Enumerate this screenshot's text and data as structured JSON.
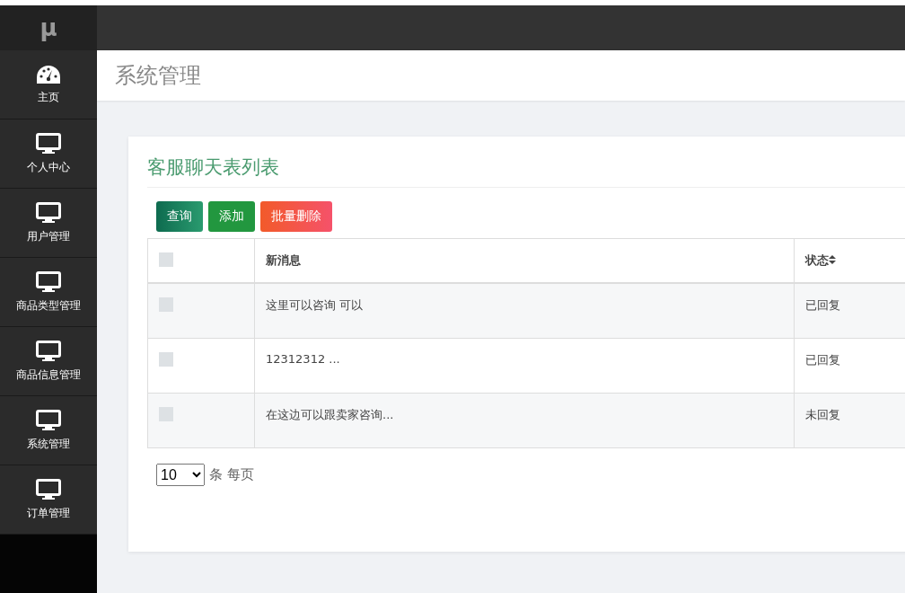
{
  "sidebar": {
    "logo": "μ",
    "items": [
      {
        "label": "主页",
        "kind": "dashboard",
        "selected": false
      },
      {
        "label": "个人中心",
        "kind": "module",
        "selected": false
      },
      {
        "label": "用户管理",
        "kind": "module",
        "selected": false
      },
      {
        "label": "商品类型管理",
        "kind": "module",
        "selected": false
      },
      {
        "label": "商品信息管理",
        "kind": "module",
        "selected": false
      },
      {
        "label": "系统管理",
        "kind": "module",
        "selected": false
      },
      {
        "label": "订单管理",
        "kind": "module",
        "selected": false
      }
    ]
  },
  "header": {
    "title": "系统管理"
  },
  "card": {
    "title": "客服聊天表列表",
    "buttons": [
      {
        "label": "查询",
        "kind": "search"
      },
      {
        "label": "添加",
        "kind": "add"
      },
      {
        "label": "批量删除",
        "kind": "delete"
      }
    ],
    "table": {
      "select_all": {
        "checked": false
      },
      "columns": [
        "新消息",
        "状态"
      ],
      "rows": [
        {
          "checked": false,
          "message": "这里可以咨询 可以",
          "status": "已回复"
        },
        {
          "checked": false,
          "message": "12312312 ...",
          "status": "已回复"
        },
        {
          "checked": false,
          "message": "在这边可以跟卖家咨询...",
          "status": "未回复"
        }
      ]
    },
    "page_size": {
      "value": "10",
      "suffix": "条 每页"
    }
  }
}
